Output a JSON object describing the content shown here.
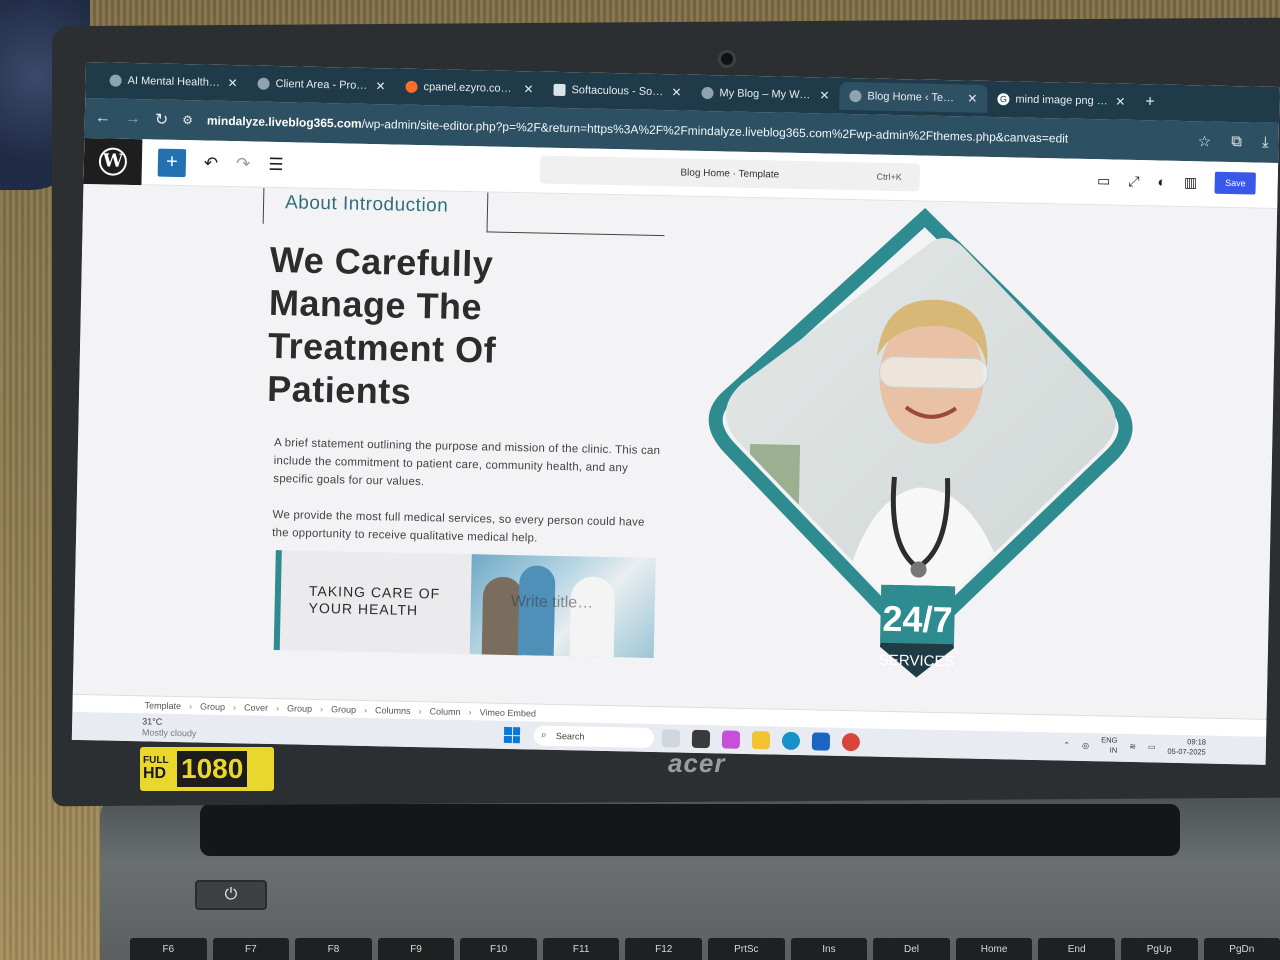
{
  "browser": {
    "tabs": [
      {
        "label": "AI Mental Health Na",
        "icon": "globe-icon",
        "active": false
      },
      {
        "label": "Client Area - ProFree",
        "icon": "profree-icon",
        "active": false
      },
      {
        "label": "cpanel.ezyro.com/pa",
        "icon": "cpanel-icon",
        "active": false
      },
      {
        "label": "Softaculous - Softacu",
        "icon": "softaculous-icon",
        "active": false
      },
      {
        "label": "My Blog – My WordP",
        "icon": "wordpress-icon",
        "active": false
      },
      {
        "label": "Blog Home ‹ Templa",
        "icon": "wordpress-icon",
        "active": true
      },
      {
        "label": "mind image png - G",
        "icon": "google-icon",
        "active": false
      }
    ],
    "new_tab": "+",
    "url_domain": "mindalyze.liveblog365.com",
    "url_path": "/wp-admin/site-editor.php?p=%2F&return=https%3A%2F%2Fmindalyze.liveblog365.com%2Fwp-admin%2Fthemes.php&canvas=edit"
  },
  "editor": {
    "document_title": "Blog Home · Template",
    "shortcut": "Ctrl+K",
    "save_label": "Save"
  },
  "page": {
    "about_label": "About Introduction",
    "headline": "We Carefully Manage The Treatment Of Patients",
    "paragraph1": "A brief statement outlining the purpose and mission of the clinic. This can include the commitment to patient care, community health, and any specific goals for our values.",
    "paragraph2": "We provide the most full medical services, so every person could have the opportunity to receive qualitative medical help.",
    "card_title": "TAKING CARE OF YOUR HEALTH",
    "card_overlay": "Write title…",
    "badge_top": "24/7",
    "badge_bottom": "SERVICES",
    "accent_color": "#2e8b8f"
  },
  "breadcrumbs": [
    "Template",
    "Group",
    "Cover",
    "Group",
    "Group",
    "Columns",
    "Column",
    "Vimeo Embed"
  ],
  "taskbar": {
    "weather_temp": "31°C",
    "weather_desc": "Mostly cloudy",
    "search_placeholder": "Search",
    "lang_top": "ENG",
    "lang_bottom": "IN",
    "time": "09:18",
    "date": "05-07-2025"
  },
  "hardware": {
    "brand": "acer",
    "hd_label_top": "FULL",
    "hd_label_bottom": "HD",
    "hd_resolution": "1080",
    "function_keys": [
      "F6",
      "F7",
      "F8",
      "F9",
      "F10",
      "F11",
      "F12",
      "PrtSc",
      "Ins",
      "Del",
      "Home",
      "End",
      "PgUp",
      "PgDn"
    ]
  }
}
